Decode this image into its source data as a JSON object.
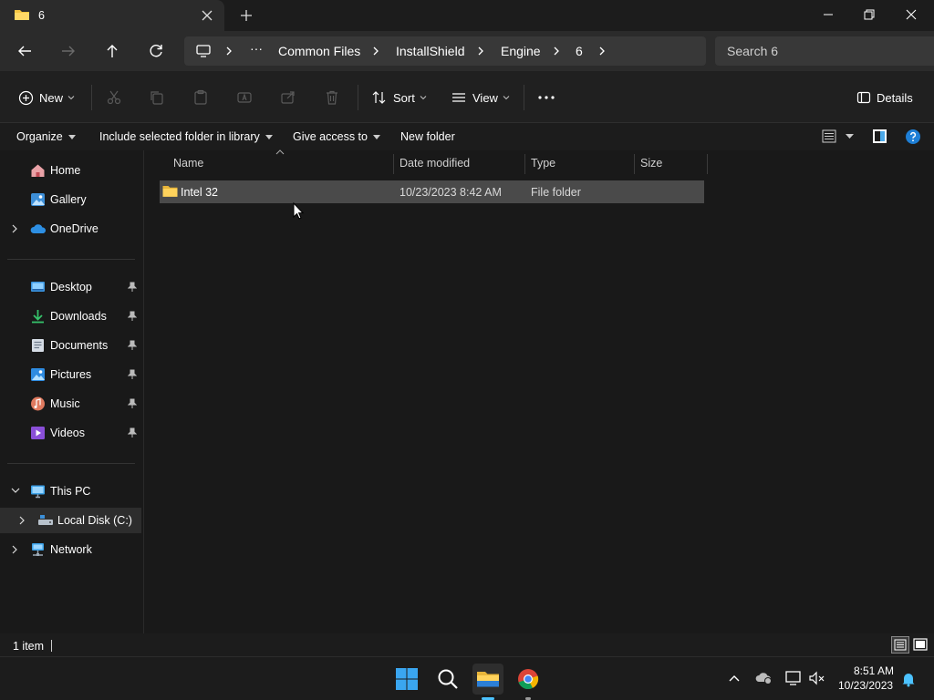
{
  "window": {
    "tab_title": "6",
    "folder_color": "#f4c542"
  },
  "address": {
    "overflow": "···",
    "crumbs": [
      "Common Files",
      "InstallShield",
      "Engine",
      "6"
    ],
    "search_placeholder": "Search 6"
  },
  "commands": {
    "new_label": "New",
    "sort_label": "Sort",
    "view_label": "View",
    "details_label": "Details"
  },
  "menubar": {
    "organize": "Organize",
    "include": "Include selected folder in library",
    "give_access": "Give access to",
    "new_folder": "New folder"
  },
  "sidebar": {
    "home": "Home",
    "gallery": "Gallery",
    "onedrive": "OneDrive",
    "desktop": "Desktop",
    "downloads": "Downloads",
    "documents": "Documents",
    "pictures": "Pictures",
    "music": "Music",
    "videos": "Videos",
    "thispc": "This PC",
    "localdisk": "Local Disk (C:)",
    "network": "Network"
  },
  "columns": {
    "name": "Name",
    "date": "Date modified",
    "type": "Type",
    "size": "Size"
  },
  "files": [
    {
      "name": "Intel 32",
      "date": "10/23/2023 8:42 AM",
      "type": "File folder",
      "size": ""
    }
  ],
  "status": {
    "count": "1 item"
  },
  "taskbar": {
    "time": "8:51 AM",
    "date": "10/23/2023"
  },
  "colors": {
    "accent": "#4cc2ff",
    "selection": "#4a4a4a",
    "background": "#191919"
  }
}
